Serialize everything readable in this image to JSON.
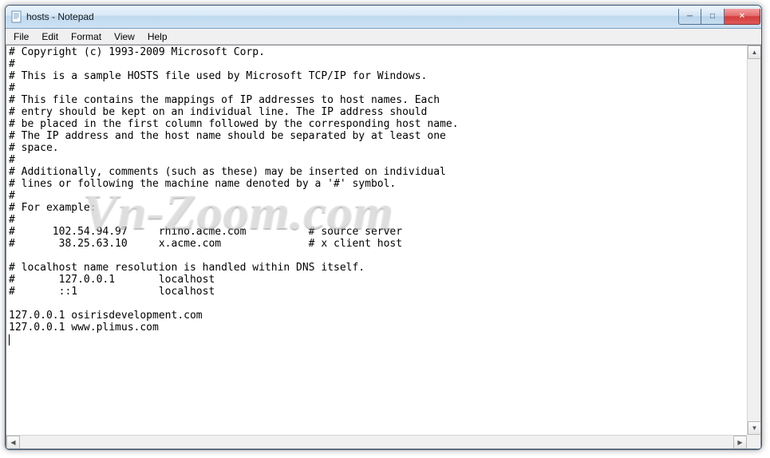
{
  "window": {
    "title": "hosts - Notepad"
  },
  "menu": {
    "file": "File",
    "edit": "Edit",
    "format": "Format",
    "view": "View",
    "help": "Help"
  },
  "controls": {
    "minimize_glyph": "─",
    "maximize_glyph": "□",
    "close_glyph": "✕"
  },
  "scroll": {
    "up": "▲",
    "down": "▼",
    "left": "◀",
    "right": "▶"
  },
  "watermark": "Vn-Zoom.com",
  "editor": {
    "content": "# Copyright (c) 1993-2009 Microsoft Corp.\n#\n# This is a sample HOSTS file used by Microsoft TCP/IP for Windows.\n#\n# This file contains the mappings of IP addresses to host names. Each\n# entry should be kept on an individual line. The IP address should\n# be placed in the first column followed by the corresponding host name.\n# The IP address and the host name should be separated by at least one\n# space.\n#\n# Additionally, comments (such as these) may be inserted on individual\n# lines or following the machine name denoted by a '#' symbol.\n#\n# For example:\n#\n#      102.54.94.97     rhino.acme.com          # source server\n#       38.25.63.10     x.acme.com              # x client host\n\n# localhost name resolution is handled within DNS itself.\n#       127.0.0.1       localhost\n#       ::1             localhost\n\n127.0.0.1 osirisdevelopment.com\n127.0.0.1 www.plimus.com\n"
  }
}
